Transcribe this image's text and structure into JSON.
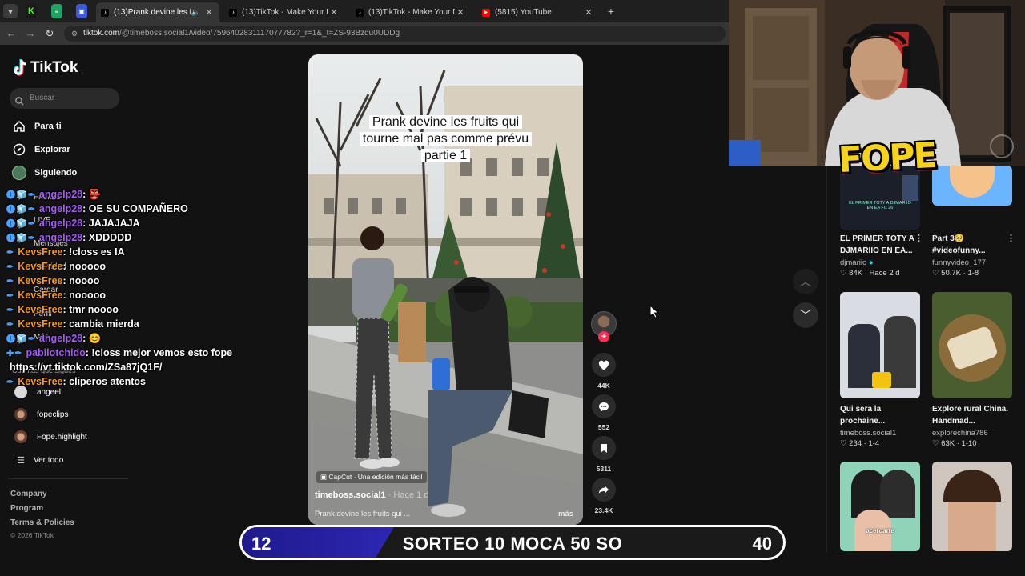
{
  "browser": {
    "tabs": [
      {
        "title": "(13)Prank devine les fruits q",
        "active": true
      },
      {
        "title": "(13)TikTok - Make Your Day",
        "active": false
      },
      {
        "title": "(13)TikTok - Make Your Day",
        "active": false
      },
      {
        "title": "(5815) YouTube",
        "active": false
      }
    ],
    "url_host": "tiktok.com",
    "url_path": "/@timeboss.social1/video/7596402831117077782?_r=1&_t=ZS-93Bzqu0UDDg"
  },
  "sidebar": {
    "brand": "TikTok",
    "search_placeholder": "Buscar",
    "nav": [
      {
        "label": "Para ti",
        "icon": "home-icon"
      },
      {
        "label": "Explorar",
        "icon": "compass-icon"
      },
      {
        "label": "Siguiendo",
        "icon": "following-icon"
      }
    ],
    "ghost_items": [
      "Friends",
      "LIVE",
      "Mensajes",
      "Actividad",
      "Cargar",
      "Perfil",
      "Más"
    ],
    "following_header": "Cuentas que sigues",
    "following": [
      "angeel",
      "fopeclips",
      "Fope.highlight"
    ],
    "see_all": "Ver todo",
    "footer": [
      "Company",
      "Program",
      "Terms & Policies"
    ],
    "copyright": "© 2026 TikTok"
  },
  "chat": [
    {
      "badges": "🅘🧊✒",
      "user": "angelp28",
      "color": "#a65cf5",
      "msg": ": 👺"
    },
    {
      "badges": "🅘🧊✒",
      "user": "angelp28",
      "color": "#a65cf5",
      "msg": ": OE SU COMPAÑERO"
    },
    {
      "badges": "🅘🧊✒",
      "user": "angelp28",
      "color": "#a65cf5",
      "msg": ": JAJAJAJA"
    },
    {
      "badges": "🅘🧊✒",
      "user": "angelp28",
      "color": "#a65cf5",
      "msg": ": XDDDDD"
    },
    {
      "badges": "✒",
      "user": "KevsFree",
      "color": "#f39c1f",
      "msg": ": !closs es IA"
    },
    {
      "badges": "✒",
      "user": "KevsFree",
      "color": "#f39c1f",
      "msg": ": nooooo"
    },
    {
      "badges": "✒",
      "user": "KevsFree",
      "color": "#f39c1f",
      "msg": ": noooo"
    },
    {
      "badges": "✒",
      "user": "KevsFree",
      "color": "#f39c1f",
      "msg": ": nooooo"
    },
    {
      "badges": "✒",
      "user": "KevsFree",
      "color": "#f39c1f",
      "msg": ": tmr noooo"
    },
    {
      "badges": "✒",
      "user": "KevsFree",
      "color": "#f39c1f",
      "msg": ": cambia mierda"
    },
    {
      "badges": "🅘🧊✒",
      "user": "angelp28",
      "color": "#a65cf5",
      "msg": ": 😊"
    },
    {
      "badges": "✚✒",
      "user": "pabilotchido",
      "color": "#a65cf5",
      "msg": ": !closs mejor vemos esto fope"
    },
    {
      "badges": "",
      "user": "",
      "color": "#ffffff",
      "msg": "https://vt.tiktok.com/ZSa87jQ1F/"
    },
    {
      "badges": "✒",
      "user": "KevsFree",
      "color": "#f39c1f",
      "msg": ": cliperos atentos"
    }
  ],
  "video": {
    "caption_lines": [
      "Prank devine les fruits qui",
      "tourne mal pas comme prévu",
      "partie 1"
    ],
    "capcut": "CapCut · Una edición más fácil",
    "author": "timeboss.social1",
    "time": " · Hace 1 d",
    "desc": "Prank devine les fruits qui ...",
    "more": "más"
  },
  "actions": {
    "likes": "44K",
    "comments": "552",
    "saves": "5311",
    "shares": "23.4K"
  },
  "related": [
    {
      "title": "EL PRIMER TOTY A DJMARIIO EN EA...",
      "author": "djmariio",
      "stat": "84K",
      "age": "Hace 2 d"
    },
    {
      "title": "Part 3🥺 #videofunny...",
      "author": "funnyvideo_177",
      "stat": "50.7K",
      "age": "1-8"
    },
    {
      "title": "Qui sera la prochaine...",
      "author": "timeboss.social1",
      "stat": "234",
      "age": "1-4"
    },
    {
      "title": "Explore rural China. Handmad...",
      "author": "explorechina786",
      "stat": "63K",
      "age": "1-10"
    }
  ],
  "thumb_texts": {
    "djmariio": "EL PRIMER TOTY A DJMARIIO EN EA FC 26",
    "acercarte": "acercarte"
  },
  "overlay": {
    "logo": "FOPE"
  },
  "banner": {
    "left": "12",
    "text": "SORTEO 10 MOCA 50 SO",
    "right": "40"
  }
}
